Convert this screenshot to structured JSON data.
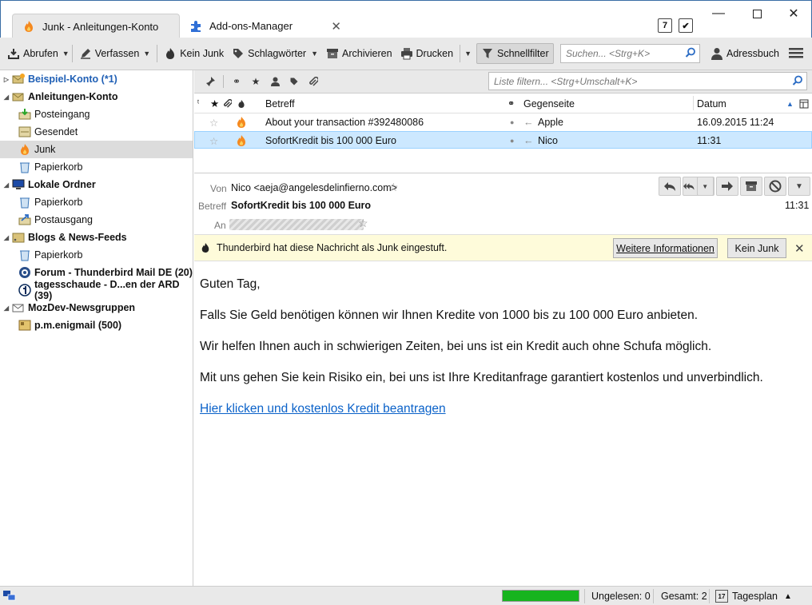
{
  "tabs": [
    {
      "label": "Junk - Anleitungen-Konto",
      "icon": "junk-flame-icon"
    },
    {
      "label": "Add-ons-Manager",
      "icon": "puzzle-icon"
    }
  ],
  "window_icons": {
    "calendar_day": "7",
    "task": "✔"
  },
  "toolbar": {
    "get_mail": "Abrufen",
    "write": "Verfassen",
    "not_junk": "Kein Junk",
    "tags": "Schlagwörter",
    "archive": "Archivieren",
    "print": "Drucken",
    "quick_filter": "Schnellfilter",
    "search_placeholder": "Suchen... <Strg+K>",
    "address_book": "Adressbuch"
  },
  "folders": [
    {
      "label": "Beispiel-Konto (*1)",
      "type": "account",
      "highlight": true
    },
    {
      "label": "Anleitungen-Konto",
      "type": "account"
    },
    {
      "label": "Posteingang",
      "type": "folder"
    },
    {
      "label": "Gesendet",
      "type": "folder"
    },
    {
      "label": "Junk",
      "type": "folder",
      "selected": true
    },
    {
      "label": "Papierkorb",
      "type": "folder"
    },
    {
      "label": "Lokale Ordner",
      "type": "account"
    },
    {
      "label": "Papierkorb",
      "type": "folder"
    },
    {
      "label": "Postausgang",
      "type": "folder"
    },
    {
      "label": "Blogs & News-Feeds",
      "type": "account"
    },
    {
      "label": "Papierkorb",
      "type": "folder"
    },
    {
      "label": "Forum - Thunderbird Mail DE (20)",
      "type": "feed"
    },
    {
      "label": "tagesschaude - D...en der ARD (39)",
      "type": "feed"
    },
    {
      "label": "MozDev-Newsgruppen",
      "type": "account"
    },
    {
      "label": "p.m.enigmail (500)",
      "type": "newsgroup"
    }
  ],
  "quickfilter": {
    "placeholder": "Liste filtern... <Strg+Umschalt+K>"
  },
  "thread_columns": {
    "subject": "Betreff",
    "correspondent": "Gegenseite",
    "date": "Datum"
  },
  "threads": [
    {
      "subject": "About your transaction #392480086",
      "correspondent": "Apple",
      "date": "16.09.2015 11:24"
    },
    {
      "subject": "SofortKredit bis 100 000 Euro",
      "correspondent": "Nico",
      "date": "11:31",
      "selected": true
    }
  ],
  "message": {
    "from_label": "Von",
    "from": "Nico <aeja@angelesdelinfierno.com>",
    "subject_label": "Betreff",
    "subject": "SofortKredit bis 100 000 Euro",
    "time": "11:31",
    "to_label": "An"
  },
  "junkbar": {
    "text": "Thunderbird hat diese Nachricht als Junk eingestuft.",
    "more_info": "Weitere Informationen",
    "not_junk": "Kein Junk"
  },
  "body": {
    "greeting": "Guten Tag,",
    "p1": "Falls Sie Geld benötigen können wir Ihnen Kredite von 1000 bis zu 100 000 Euro anbieten.",
    "p2": "Wir helfen Ihnen auch in schwierigen Zeiten, bei uns ist ein Kredit auch ohne Schufa möglich.",
    "p3": "Mit uns gehen Sie kein Risiko ein, bei uns ist Ihre Kreditanfrage garantiert kostenlos und unverbindlich.",
    "link": "Hier klicken und kostenlos Kredit beantragen"
  },
  "status": {
    "progress": 1.0,
    "unread": "Ungelesen: 0",
    "total": "Gesamt: 2",
    "today_pane": "Tagesplan",
    "today_day": "17"
  },
  "colors": {
    "accent": "#1f5fb5",
    "selection": "#cce8ff",
    "junkbar": "#fefbda",
    "progress": "#17b41e",
    "link": "#0b62c9"
  }
}
